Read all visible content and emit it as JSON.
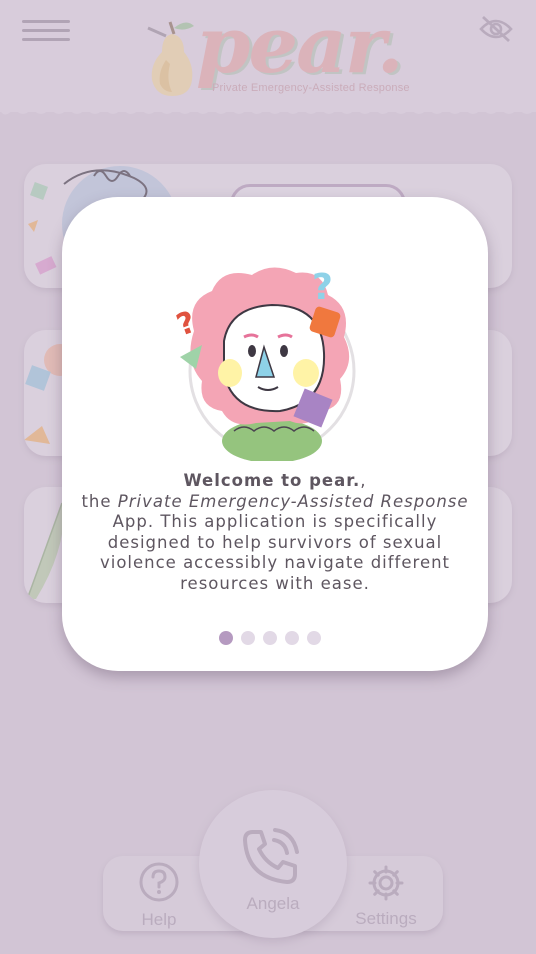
{
  "header": {
    "logo_text": "pear.",
    "tagline": "Private Emergency-Assisted Response"
  },
  "onboarding": {
    "welcome": "Welcome to pear.",
    "line_start": "the ",
    "app_name": "Private Emergency-Assisted Response",
    "rest": " App. This application is specifically designed to help survivors of sexual violence accessibly navigate different resources with ease.",
    "page_count": 5,
    "active_page": 1
  },
  "nav": {
    "help_label": "Help",
    "call_label": "Angela",
    "settings_label": "Settings"
  },
  "icons": {
    "menu": "hamburger-menu-icon",
    "hide": "eye-off-icon",
    "help": "question-circle-icon",
    "call": "phone-call-icon",
    "settings": "gear-icon"
  },
  "colors": {
    "background": "#d7cbd9",
    "accent": "#b59ac0",
    "logo": "#e7aaa8",
    "nav_text": "#ab9db0"
  }
}
